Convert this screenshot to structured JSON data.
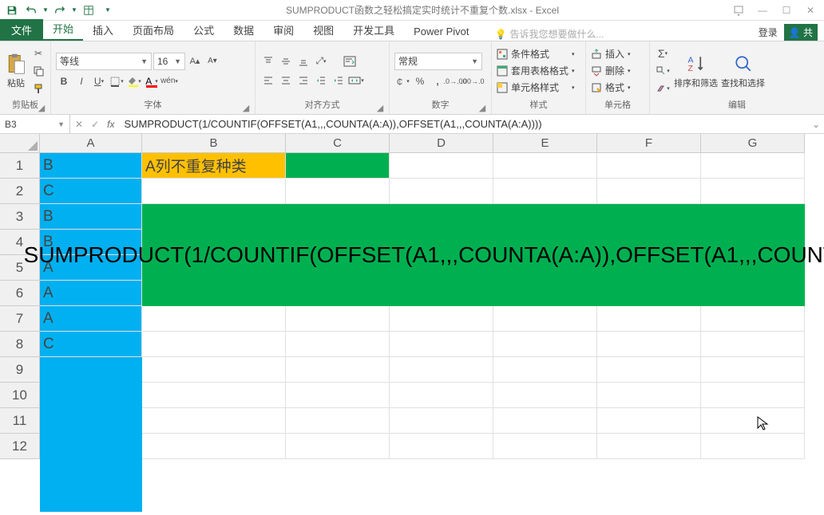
{
  "title": {
    "filename": "SUMPRODUCT函数之轻松搞定实时统计不重复个数.xlsx",
    "app": "Excel"
  },
  "tabs": {
    "file": "文件",
    "home": "开始",
    "insert": "插入",
    "layout": "页面布局",
    "formulas": "公式",
    "data": "数据",
    "review": "审阅",
    "view": "视图",
    "dev": "开发工具",
    "pivot": "Power Pivot",
    "tellme": "告诉我您想要做什么...",
    "login": "登录",
    "share": "共"
  },
  "ribbon": {
    "clipboard": {
      "paste": "粘贴",
      "label": "剪贴板"
    },
    "font": {
      "name": "等线",
      "size": "16",
      "label": "字体"
    },
    "align": {
      "label": "对齐方式"
    },
    "number": {
      "format": "常规",
      "label": "数字"
    },
    "styles": {
      "cond": "条件格式",
      "table": "套用表格格式",
      "cell": "单元格样式",
      "label": "样式"
    },
    "cells": {
      "insert": "插入",
      "delete": "删除",
      "format": "格式",
      "label": "单元格"
    },
    "editing": {
      "sort": "排序和筛选",
      "find": "查找和选择",
      "label": "编辑"
    }
  },
  "namebox": "B3",
  "formula": "SUMPRODUCT(1/COUNTIF(OFFSET(A1,,,COUNTA(A:A)),OFFSET(A1,,,COUNTA(A:A))))",
  "columns": [
    "A",
    "B",
    "C",
    "D",
    "E",
    "F",
    "G"
  ],
  "rows": [
    "1",
    "2",
    "3",
    "4",
    "5",
    "6",
    "7",
    "8",
    "9",
    "10",
    "11",
    "12"
  ],
  "colA": [
    "B",
    "C",
    "B",
    "B",
    "A",
    "A",
    "A",
    "C"
  ],
  "b1": "A列不重复种类",
  "big_formula": "SUMPRODUCT(1/COUNTIF(OFFSET(A1,,,COUNTA(A:A)),OFFSET(A1,,,COUNTA(A:A))))"
}
